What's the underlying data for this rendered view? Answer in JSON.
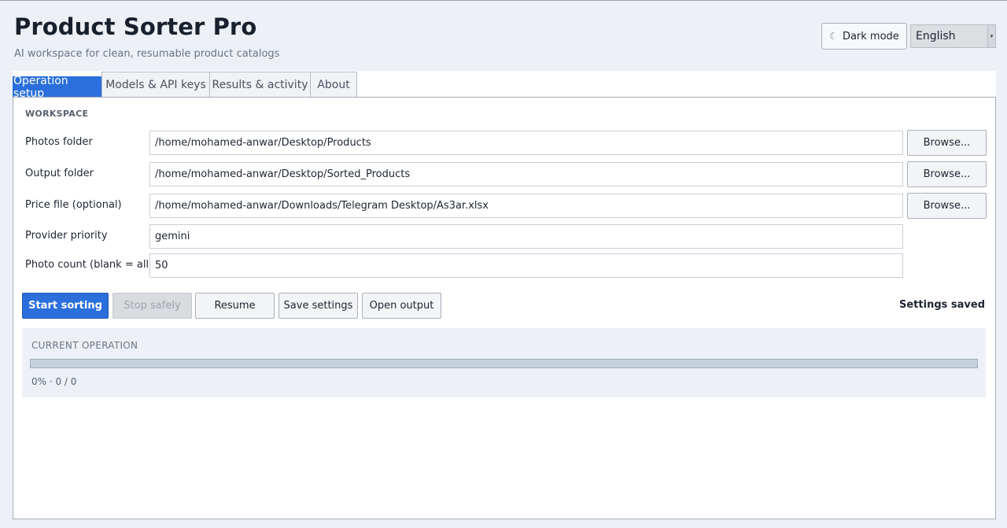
{
  "header": {
    "title": "Product Sorter Pro",
    "subtitle": "AI workspace for clean, resumable product catalogs",
    "dark_mode_icon": "moon-icon",
    "dark_mode_label": "Dark mode",
    "language_selected": "English"
  },
  "tabs": [
    {
      "label": "Operation setup",
      "active": true
    },
    {
      "label": "Models & API keys",
      "active": false
    },
    {
      "label": "Results & activity",
      "active": false
    },
    {
      "label": "About",
      "active": false
    }
  ],
  "workspace": {
    "section_label": "WORKSPACE",
    "fields": [
      {
        "label": "Photos folder",
        "value": "/home/mohamed-anwar/Desktop/Products",
        "browse": "Browse..."
      },
      {
        "label": "Output folder",
        "value": "/home/mohamed-anwar/Desktop/Sorted_Products",
        "browse": "Browse..."
      },
      {
        "label": "Price file (optional)",
        "value": "/home/mohamed-anwar/Downloads/Telegram Desktop/As3ar.xlsx",
        "browse": "Browse..."
      },
      {
        "label": "Provider priority",
        "value": "gemini"
      },
      {
        "label": "Photo count (blank = all)",
        "value": "50"
      }
    ]
  },
  "actions": {
    "start": "Start sorting",
    "stop": "Stop safely",
    "resume": "Resume",
    "save": "Save settings",
    "open_output": "Open output",
    "status": "Settings saved"
  },
  "operation": {
    "title": "CURRENT OPERATION",
    "progress_fraction": 0,
    "progress_text": "0% · 0 / 0"
  },
  "colors": {
    "accent": "#2a6fdb",
    "background": "#edf1f7"
  }
}
